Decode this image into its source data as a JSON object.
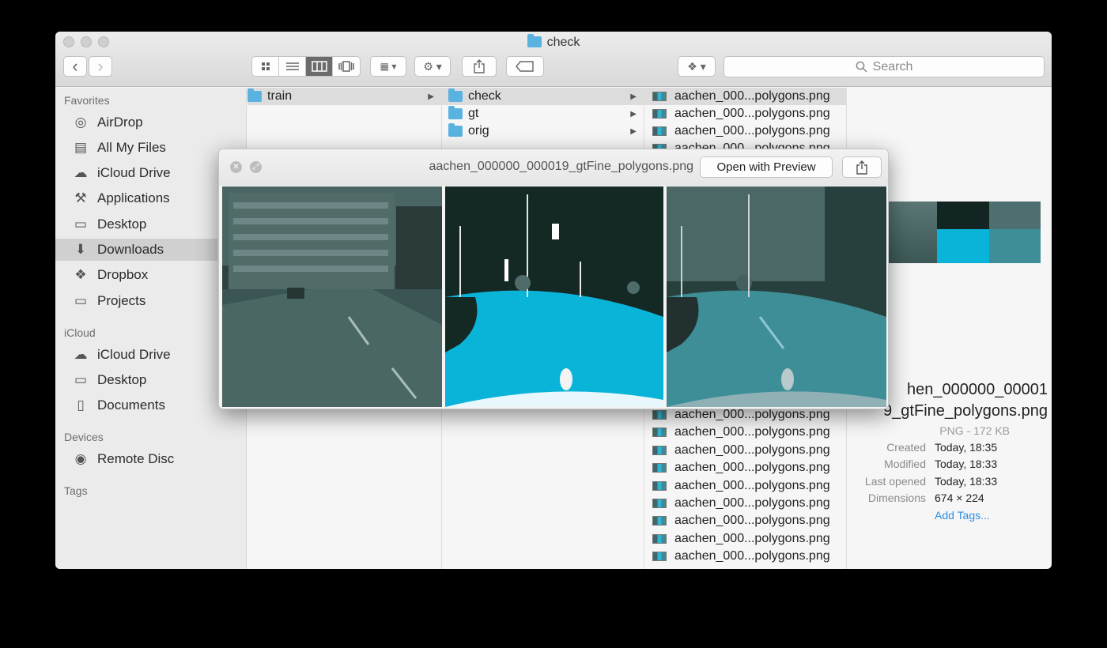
{
  "window": {
    "title": "check"
  },
  "toolbar": {
    "back_glyph": "‹",
    "forward_glyph": "›",
    "view_icons": [
      "icon-view-icon",
      "list-view-icon",
      "column-view-icon",
      "cover-flow-view-icon"
    ],
    "active_view": "column-view-icon",
    "arrange_glyph": "▦ ▾",
    "action_glyph": "⚙ ▾",
    "share_glyph": "⇪",
    "tag_glyph": "⬭",
    "dropbox_glyph": "❖ ▾",
    "search_placeholder": "Search"
  },
  "sidebar": {
    "favorites_header": "Favorites",
    "favorites": [
      {
        "label": "AirDrop",
        "icon": "airdrop-icon",
        "glyph": "◎"
      },
      {
        "label": "All My Files",
        "icon": "all-files-icon",
        "glyph": "▤"
      },
      {
        "label": "iCloud Drive",
        "icon": "cloud-icon",
        "glyph": "☁"
      },
      {
        "label": "Applications",
        "icon": "applications-icon",
        "glyph": "⚒"
      },
      {
        "label": "Desktop",
        "icon": "desktop-icon",
        "glyph": "▭"
      },
      {
        "label": "Downloads",
        "icon": "downloads-icon",
        "glyph": "⬇"
      },
      {
        "label": "Dropbox",
        "icon": "dropbox-icon",
        "glyph": "❖"
      },
      {
        "label": "Projects",
        "icon": "folder-icon",
        "glyph": "▭"
      }
    ],
    "selected": "Downloads",
    "icloud_header": "iCloud",
    "icloud": [
      {
        "label": "iCloud Drive",
        "icon": "cloud-icon",
        "glyph": "☁"
      },
      {
        "label": "Desktop",
        "icon": "desktop-icon",
        "glyph": "▭"
      },
      {
        "label": "Documents",
        "icon": "documents-icon",
        "glyph": "▯"
      }
    ],
    "devices_header": "Devices",
    "devices": [
      {
        "label": "Remote Disc",
        "icon": "disc-icon",
        "glyph": "◉"
      }
    ],
    "tags_header": "Tags"
  },
  "columns": {
    "col1": [
      {
        "label": "train",
        "selected": true
      }
    ],
    "col2": [
      {
        "label": "check",
        "selected": true
      },
      {
        "label": "gt",
        "selected": false
      },
      {
        "label": "orig",
        "selected": false
      }
    ],
    "col3_top": [
      "aachen_000...polygons.png",
      "aachen_000...polygons.png",
      "aachen_000...polygons.png",
      "aachen_000...polygons.png"
    ],
    "col3_bottom": [
      "aachen_000...polygons.png",
      "aachen_000...polygons.png",
      "aachen_000...polygons.png",
      "aachen_000...polygons.png",
      "aachen_000...polygons.png",
      "aachen_000...polygons.png",
      "aachen_000...polygons.png",
      "aachen_000...polygons.png",
      "aachen_000...polygons.png"
    ]
  },
  "info": {
    "name_line1": "hen_000000_00001",
    "name_line2": "9_gtFine_polygons.png",
    "kind_size": "PNG - 172 KB",
    "created_label": "Created",
    "created_value": "Today, 18:35",
    "modified_label": "Modified",
    "modified_value": "Today, 18:33",
    "opened_label": "Last opened",
    "opened_value": "Today, 18:33",
    "dimensions_label": "Dimensions",
    "dimensions_value": "674 × 224",
    "add_tags": "Add Tags..."
  },
  "quicklook": {
    "title": "aachen_000000_000019_gtFine_polygons.png",
    "open_button": "Open with Preview",
    "close_glyph": "✕",
    "fullscreen_glyph": "⤢",
    "share_glyph": "⇪"
  },
  "colors": {
    "road_cyan": "#0ab4d8",
    "segmentation_black": "#142824",
    "street_gray": "#3f5f5c",
    "overlay_teal": "#3e8e98"
  }
}
